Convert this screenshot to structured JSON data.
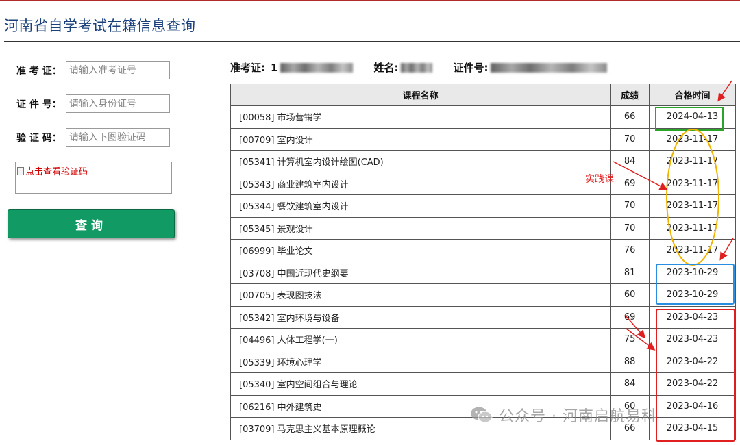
{
  "page": {
    "title": "河南省自学考试在籍信息查询"
  },
  "form": {
    "exam_id_label": "准 考 证：",
    "exam_id_placeholder": "请输入准考证号",
    "id_number_label": "证 件 号：",
    "id_number_placeholder": "请输入身份证号",
    "captcha_label": "验 证 码：",
    "captcha_placeholder": "请输入下图验证码",
    "captcha_image_alt": "点击查看验证码",
    "submit_label": "查询"
  },
  "info": {
    "exam_id_label": "准考证:",
    "exam_id_visible_prefix": "1",
    "name_label": "姓名:",
    "id_label": "证件号:"
  },
  "table": {
    "headers": [
      "课程名称",
      "成绩",
      "合格时间"
    ],
    "rows": [
      {
        "course": "[00058] 市场营销学",
        "score": "66",
        "date": "2024-04-13"
      },
      {
        "course": "[00709] 室内设计",
        "score": "70",
        "date": "2023-11-17"
      },
      {
        "course": "[05341] 计算机室内设计绘图(CAD)",
        "score": "84",
        "date": "2023-11-17"
      },
      {
        "course": "[05343] 商业建筑室内设计",
        "score": "69",
        "date": "2023-11-17"
      },
      {
        "course": "[05344] 餐饮建筑室内设计",
        "score": "70",
        "date": "2023-11-17"
      },
      {
        "course": "[05345] 景观设计",
        "score": "70",
        "date": "2023-11-17"
      },
      {
        "course": "[06999] 毕业论文",
        "score": "76",
        "date": "2023-11-17"
      },
      {
        "course": "[03708] 中国近现代史纲要",
        "score": "81",
        "date": "2023-10-29"
      },
      {
        "course": "[00705] 表现图技法",
        "score": "60",
        "date": "2023-10-29"
      },
      {
        "course": "[05342] 室内环境与设备",
        "score": "69",
        "date": "2023-04-23"
      },
      {
        "course": "[04496] 人体工程学(一)",
        "score": "75",
        "date": "2023-04-23"
      },
      {
        "course": "[05339] 环境心理学",
        "score": "88",
        "date": "2023-04-22"
      },
      {
        "course": "[05340] 室内空间组合与理论",
        "score": "84",
        "date": "2023-04-22"
      },
      {
        "course": "[06216] 中外建筑史",
        "score": "60",
        "date": "2023-04-16"
      },
      {
        "course": "[03709] 马克思主义基本原理概论",
        "score": "66",
        "date": "2023-04-15"
      }
    ]
  },
  "annotations": {
    "practice_label": "实践课",
    "colors": {
      "green": "#2aa52a",
      "yellow": "#f0b400",
      "blue": "#2a8ee0",
      "red": "#e02020"
    }
  },
  "watermark": {
    "text": "公众号 · 河南启航易科"
  }
}
